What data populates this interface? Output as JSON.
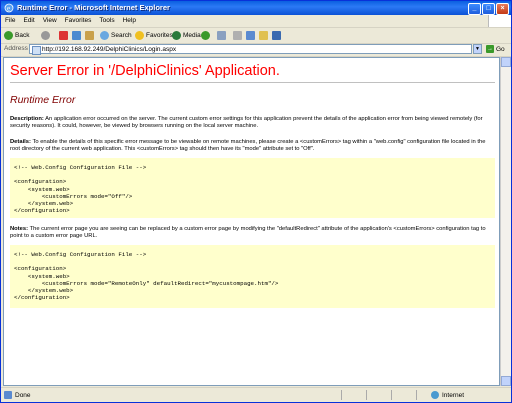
{
  "window": {
    "title": "Runtime Error - Microsoft Internet Explorer",
    "controls": [
      "_",
      "□",
      "×"
    ]
  },
  "menu": [
    "File",
    "Edit",
    "View",
    "Favorites",
    "Tools",
    "Help"
  ],
  "toolbar": {
    "back": "Back",
    "search": "Search",
    "favorites": "Favorites",
    "media": "Media"
  },
  "address": {
    "label": "Address",
    "url": "http://192.168.92.249/DelphiClinics/Login.aspx",
    "go": "Go"
  },
  "page": {
    "heading": "Server Error in '/DelphiClinics' Application.",
    "subheading": "Runtime Error",
    "description_label": "Description:",
    "description": "An application error occurred on the server. The current custom error settings for this application prevent the details of the application error from being viewed remotely (for security reasons). It could, however, be viewed by browsers running on the local server machine.",
    "details_label": "Details:",
    "details": "To enable the details of this specific error message to be viewable on remote machines, please create a <customErrors> tag within a \"web.config\" configuration file located in the root directory of the current web application. This <customErrors> tag should then have its \"mode\" attribute set to \"Off\".",
    "code1": "<!-- Web.Config Configuration File -->\n\n<configuration>\n    <system.web>\n        <customErrors mode=\"Off\"/>\n    </system.web>\n</configuration>",
    "notes_label": "Notes:",
    "notes": "The current error page you are seeing can be replaced by a custom error page by modifying the \"defaultRedirect\" attribute of the application's <customErrors> configuration tag to point to a custom error page URL.",
    "code2": "<!-- Web.Config Configuration File -->\n\n<configuration>\n    <system.web>\n        <customErrors mode=\"RemoteOnly\" defaultRedirect=\"mycustompage.htm\"/>\n    </system.web>\n</configuration>"
  },
  "status": {
    "text": "Done",
    "zone": "Internet"
  },
  "colors": {
    "titlebar": "#0a5fe0",
    "heading": "#ff0000",
    "subheading": "#800000",
    "code_bg": "#ffffcc"
  }
}
